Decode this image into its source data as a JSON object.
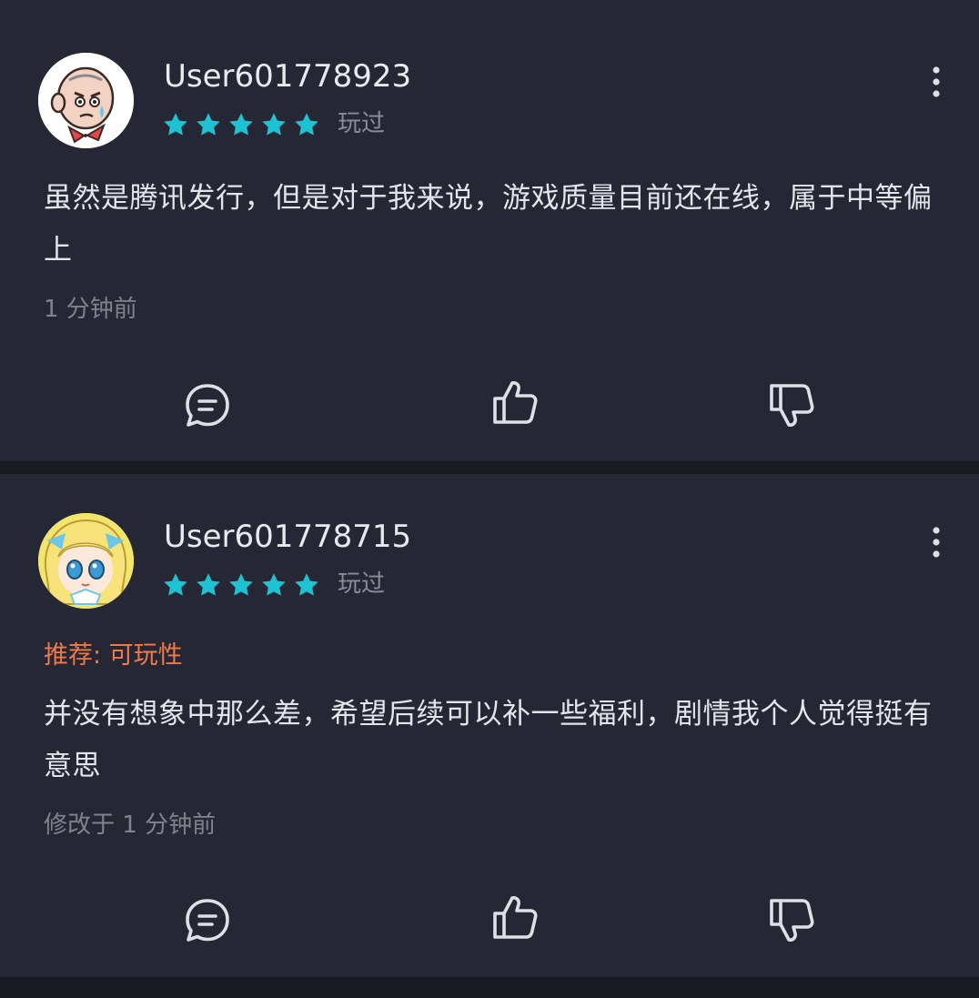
{
  "reviews": [
    {
      "username": "User601778923",
      "rating": 5,
      "status": "玩过",
      "tag": "",
      "content": "虽然是腾讯发行，但是对于我来说，游戏质量目前还在线，属于中等偏上",
      "time": "1 分钟前",
      "avatar_icon": "bald-old-man-avatar"
    },
    {
      "username": "User601778715",
      "rating": 5,
      "status": "玩过",
      "tag": "推荐: 可玩性",
      "content": "并没有想象中那么差，希望后续可以补一些福利，剧情我个人觉得挺有意思",
      "time": "修改于 1 分钟前",
      "avatar_icon": "anime-girl-avatar"
    }
  ],
  "colors": {
    "background": "#191b22",
    "card": "#252834",
    "star": "#1ec2d2",
    "tag": "#ee7a4c",
    "icon": "#dfe0e5"
  },
  "icons": {
    "reply": "comment-bubble-icon",
    "like": "thumbs-up-icon",
    "dislike": "thumbs-down-icon",
    "more": "vertical-dots-icon"
  }
}
